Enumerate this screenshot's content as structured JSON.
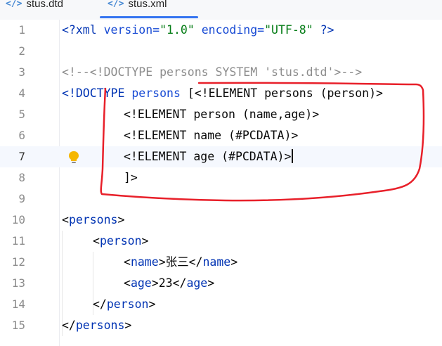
{
  "tabs": [
    {
      "label": "stus.dtd",
      "icon": "xml-file-icon",
      "active": false
    },
    {
      "label": "stus.xml",
      "icon": "xml-file-icon",
      "active": true
    }
  ],
  "file_icon_glyph": "</>",
  "editor": {
    "current_line": 7,
    "lines": [
      {
        "n": "1"
      },
      {
        "n": "2"
      },
      {
        "n": "3"
      },
      {
        "n": "4"
      },
      {
        "n": "5"
      },
      {
        "n": "6"
      },
      {
        "n": "7"
      },
      {
        "n": "8"
      },
      {
        "n": "9"
      },
      {
        "n": "10"
      },
      {
        "n": "11"
      },
      {
        "n": "12"
      },
      {
        "n": "13"
      },
      {
        "n": "14"
      },
      {
        "n": "15"
      }
    ],
    "code": {
      "l1": {
        "decl_open": "<?xml ",
        "version_attr": "version=",
        "version_val": "\"1.0\"",
        "enc_attr": " encoding=",
        "enc_val": "\"UTF-8\"",
        "decl_close": " ?>"
      },
      "l3": {
        "comment": "<!--<!DOCTYPE persons SYSTEM 'stus.dtd'>-->"
      },
      "l4": {
        "doctype": "<!DOCTYPE ",
        "root": "persons",
        "rest": " [<!ELEMENT persons (person)>"
      },
      "l5": {
        "text": "<!ELEMENT person (name,age)>"
      },
      "l6": {
        "text": "<!ELEMENT name (#PCDATA)>"
      },
      "l7": {
        "text": "<!ELEMENT age (#PCDATA)>"
      },
      "l8": {
        "text": "]>"
      },
      "l10": {
        "open": "<",
        "name": "persons",
        "close": ">"
      },
      "l11": {
        "open": "<",
        "name": "person",
        "close": ">"
      },
      "l12": {
        "open": "<",
        "name": "name",
        "close": ">",
        "value": "张三",
        "end_open": "</",
        "end_name": "name",
        "end_close": ">"
      },
      "l13": {
        "open": "<",
        "name": "age",
        "close": ">",
        "value": "23",
        "end_open": "</",
        "end_name": "age",
        "end_close": ">"
      },
      "l14": {
        "open": "</",
        "name": "person",
        "close": ">"
      },
      "l15": {
        "open": "</",
        "name": "persons",
        "close": ">"
      }
    }
  },
  "colors": {
    "tag": "#0033b3",
    "string": "#067d17",
    "comment": "#8c8c8c",
    "annotation": "#e8202a",
    "bulb": "#f5b700"
  }
}
